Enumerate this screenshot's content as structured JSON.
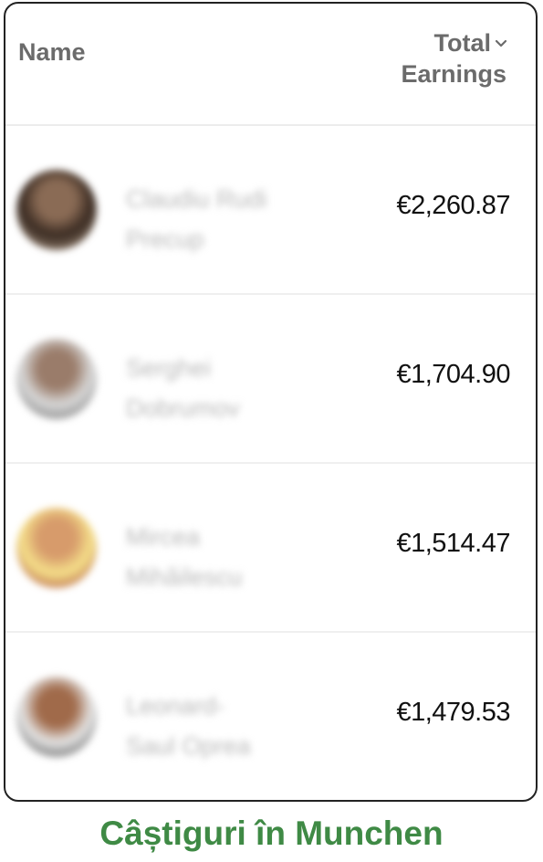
{
  "header": {
    "name_label": "Name",
    "total_label_line1": "Total",
    "total_label_line2": "Earnings"
  },
  "rows": [
    {
      "name_line1": "Claudiu Rudi",
      "name_line2": "Precup",
      "amount": "€2,260.87",
      "avatar_colors": [
        "#3a2b22",
        "#8a6b55",
        "#c9b49e"
      ]
    },
    {
      "name_line1": "Serghei",
      "name_line2": "Dobrumov",
      "amount": "€1,704.90",
      "avatar_colors": [
        "#d8d8d8",
        "#9a7c6a",
        "#5a5a5a"
      ]
    },
    {
      "name_line1": "Mircea",
      "name_line2": "Mihăilescu",
      "amount": "€1,514.47",
      "avatar_colors": [
        "#f5e08a",
        "#d79b6b",
        "#9b2d2d"
      ]
    },
    {
      "name_line1": "Leonard-",
      "name_line2": "Saul Oprea",
      "amount": "€1,479.53",
      "avatar_colors": [
        "#e5e5e5",
        "#a06a4a",
        "#2a2a2a"
      ]
    }
  ],
  "caption": "Câștiguri în Munchen",
  "colors": {
    "caption": "#3f8a45",
    "header_text": "#6b6b6b",
    "amount_text": "#111111"
  }
}
